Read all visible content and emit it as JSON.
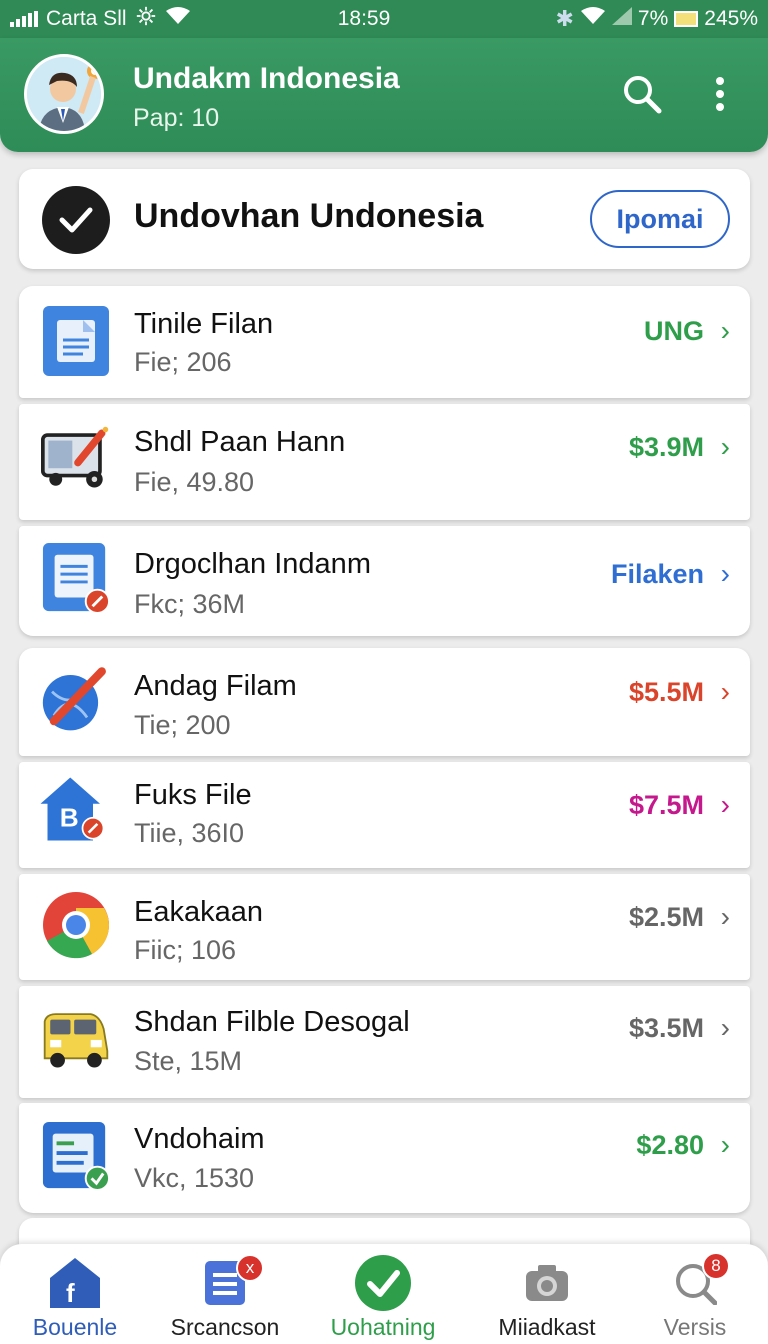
{
  "status_bar": {
    "carrier": "Carta Sll",
    "time": "18:59",
    "battery_small": "7%",
    "battery_large": "245%",
    "icons": [
      "signal-icon",
      "settings-gear-icon",
      "wifi-icon",
      "bluetooth-icon",
      "wifi-icon",
      "battery-icon"
    ]
  },
  "app_bar": {
    "title": "Undakm Indonesia",
    "subtitle": "Pap: 10",
    "icons": [
      "avatar",
      "search-icon",
      "more-vert-icon"
    ]
  },
  "header_card": {
    "title": "Undovhan Undonesia",
    "button_label": "Ipomai"
  },
  "list": [
    {
      "title": "Tinile Filan",
      "sub": "Fie; 206",
      "value": "UNG",
      "value_color": "#2e9e4a",
      "icon": "document-icon"
    },
    {
      "title": "Shdl Paan Hann",
      "sub": "Fie, 49.80",
      "value": "$3.9M",
      "value_color": "#2e9e4a",
      "icon": "machine-icon"
    },
    {
      "title": "Drgoclhan Indanm",
      "sub": "Fkc; 36M",
      "value": "Filaken",
      "value_color": "#2f6ed2",
      "icon": "document-link-icon"
    },
    {
      "title": "Andag Filam",
      "sub": "Tie; 200",
      "value": "$5.5M",
      "value_color": "#d9442a",
      "icon": "globe-pen-icon"
    },
    {
      "title": "Fuks File",
      "sub": "Tiie, 36I0",
      "value": "$7.5M",
      "value_color": "#c4188c",
      "icon": "home-b-icon"
    },
    {
      "title": "Eakakaan",
      "sub": "Fiic; 106",
      "value": "$2.5M",
      "value_color": "#666666",
      "icon": "chrome-icon"
    },
    {
      "title": "Shdan Filble Desogal",
      "sub": "Ste, 15M",
      "value": "$3.5M",
      "value_color": "#666666",
      "icon": "truck-icon"
    },
    {
      "title": "Vndohaim",
      "sub": "Vkc, 1530",
      "value": "$2.80",
      "value_color": "#2e9e4a",
      "icon": "form-check-icon"
    }
  ],
  "bottom_nav": [
    {
      "label": "Bouenle",
      "color": "#2f5db8",
      "icon": "facebook-home-icon"
    },
    {
      "label": "Srcancson",
      "color": "#222222",
      "icon": "list-doc-icon",
      "badge": "x"
    },
    {
      "label": "Uohatning",
      "color": "#2e9e4a",
      "icon": "check-circle-icon"
    },
    {
      "label": "Miiadkast",
      "color": "#222222",
      "icon": "camera-icon"
    },
    {
      "label": "Versis",
      "color": "#777777",
      "icon": "search-icon",
      "badge": "8"
    }
  ]
}
